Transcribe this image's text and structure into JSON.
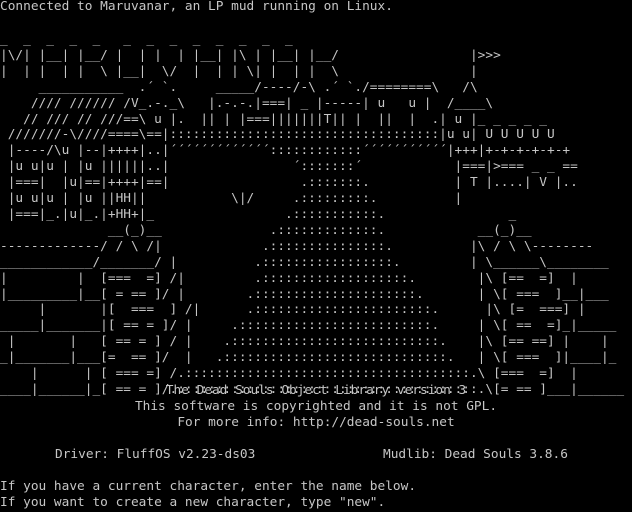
{
  "terminal": {
    "connect_line": "Connected to Maruvanar, an LP mud running on Linux.",
    "banner_art": [
      "_  _  _  _  _   _  _  _  _  _  _  _  _",
      "|\\/| |__| |__/ |  | |  | |__| |\\ | |__| |__/                 |>>>",
      "|  | |  | |  \\ |__|  \\/  |  | | \\| |  | |  \\                 |",
      "     ___________  .´ `.     _____/----/-\\ .´ `./========\\   /\\",
      "    //// ////// /V_.-._\\   |.-.-.|===| _ |-----| u   u |  /____\\",
      "   // /// // ///==\\ u |.  || | |===|||||||T|| |  ||  |  .| u |_ _ _ _ _",
      " ///////-\\////====\\==|:::::::::::::::::::::::::::::::::::|u u| U U U U U",
      " |----/\\u |--|++++|..|´´´´´´´´´´´´´::::::::::::´´´´´´´´´´´|+++|+-+-+-+-+-+",
      " |u u|u | |u ||||||..|                ´:::::::´            |===|>=== _ _ ==",
      " |===|  |u|==|++++|==|                 .:::::::.           | T |....| V |..",
      " |u u|u | |u ||HH||           \\|/     .:::::::::.          |",
      " |===|_.|u|_.|+HH+|_                 .:::::::::::.                _",
      "              __(_)__              .:::::::::::::.            __(_)__",
      "-------------/ / \\ /|             .:::::::::::::::.          |\\ / \\ \\--------",
      "____________/_______/ |          .:::::::::::::::::.         | \\______\\________",
      "|         |  [===  =] /|         .:::::::::::::::::::.        |\\ [==  =]  |",
      "|_________|__[ = == ]/ |        .:::::::::::::::::::::.       | \\[ ===  ]__|___",
      "     |       |[  ===  ] /|      .:::::::::::::::::::::::.      |\\ [=  ===] |",
      "_____|_______|[ == = ]/ |     .:::::::::::::::::::::::::.     | \\[ ==  =]_|_____",
      " |       |   [ == = ] / |    .:::::::::::::::::::::::::::.    |\\ [== ==] |    |",
      "_|_______|___[=  == ]/  |   .:::::::::::::::::::::::::::::.   | \\[ ===  ]|____|_",
      "    |      | [ === =] /.:::::::::::::::::::::::::::::::::::::.\\ [===  =]  |",
      "____|______|_[ == = ]/.:::::::::::::::::::::::::::::::::::::::.\\[= == ]___|______"
    ],
    "lib_title": "The Dead Souls Object Library version 3",
    "copyright": "This software is copyrighted and it is not GPL.",
    "more_info": "For more info: http://dead-souls.net",
    "driver_label": "Driver: FluffOS v2.23-ds03",
    "mudlib_label": "Mudlib: Dead Souls 3.8.6",
    "prompt_existing": "If you have a current character, enter the name below.",
    "prompt_new": "If you want to create a new character, type \"new\"."
  }
}
